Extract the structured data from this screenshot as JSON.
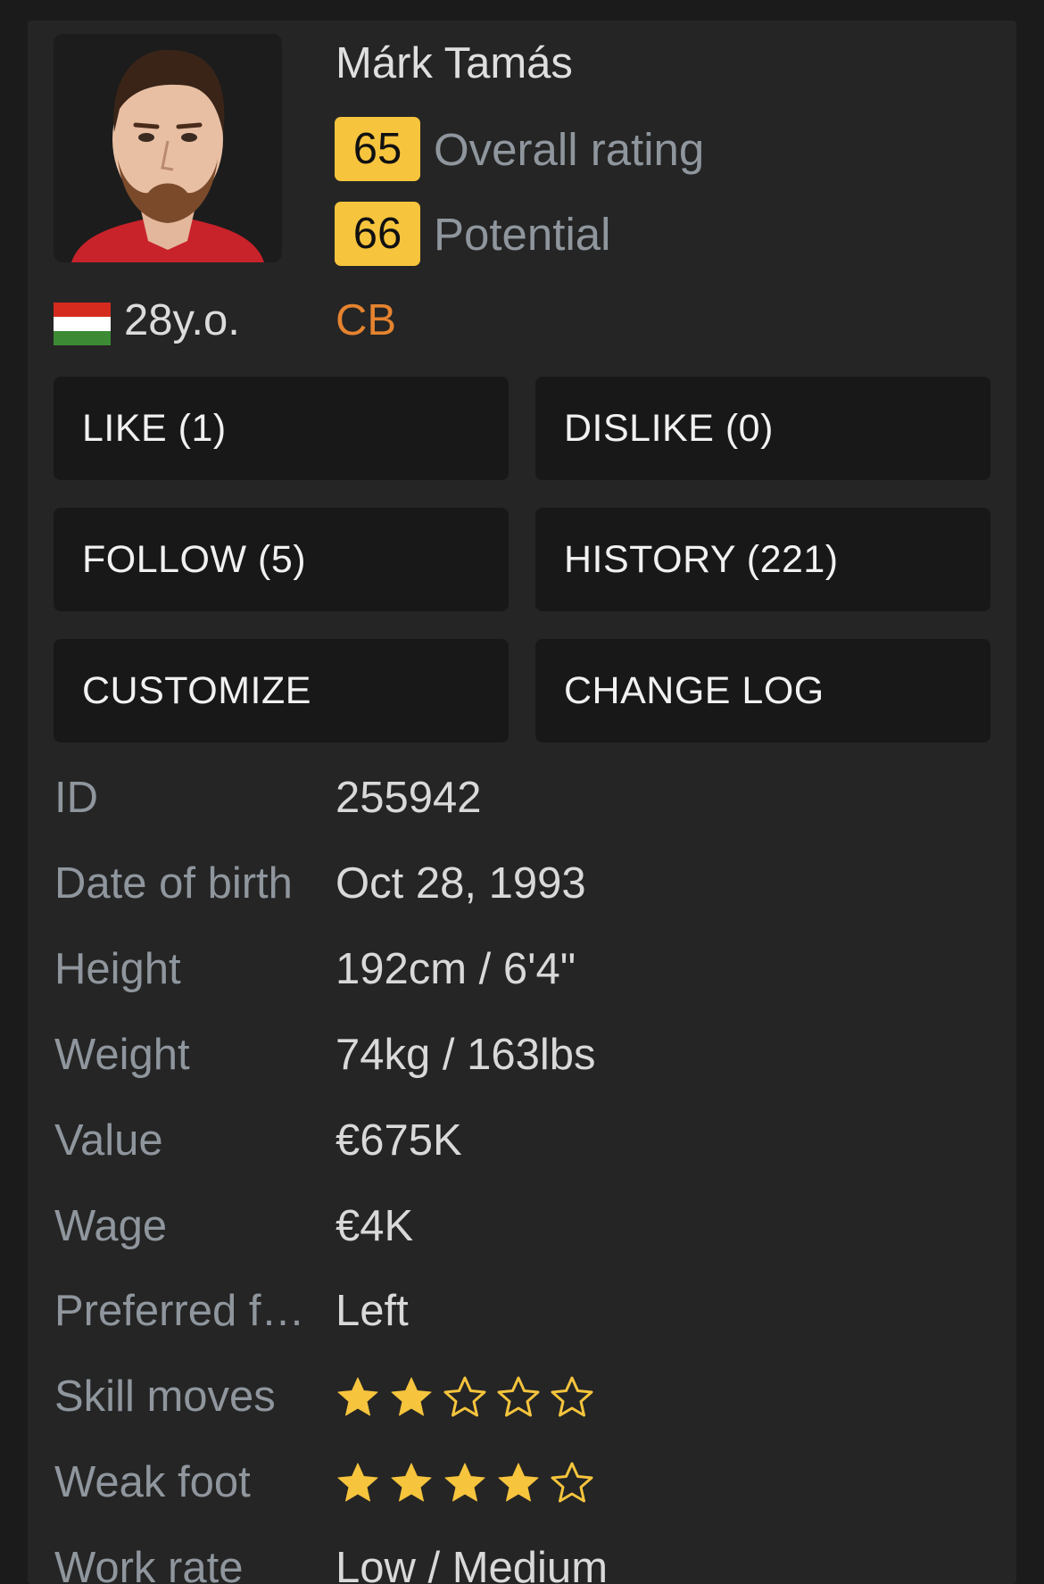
{
  "player": {
    "name": "Márk Tamás",
    "overall": "65",
    "overall_label": "Overall rating",
    "potential": "66",
    "potential_label": "Potential",
    "age": "28y.o.",
    "position": "CB",
    "flag_icon": "hungary-flag-icon"
  },
  "colors": {
    "badge": "#f6c43d",
    "position": "#e5832f",
    "star": "#f6c43d",
    "background": "#252525",
    "button": "#181818"
  },
  "buttons": {
    "like": "LIKE (1)",
    "dislike": "DISLIKE (0)",
    "follow": "FOLLOW (5)",
    "history": "HISTORY (221)",
    "customize": "CUSTOMIZE",
    "changelog": "CHANGE LOG"
  },
  "info": {
    "id": {
      "label": "ID",
      "value": "255942"
    },
    "dob": {
      "label": "Date of birth",
      "value": "Oct 28, 1993"
    },
    "height": {
      "label": "Height",
      "value": "192cm / 6'4\""
    },
    "weight": {
      "label": "Weight",
      "value": "74kg / 163lbs"
    },
    "value": {
      "label": "Value",
      "value": "€675K"
    },
    "wage": {
      "label": "Wage",
      "value": "€4K"
    },
    "foot": {
      "label": "Preferred foot",
      "value": "Left"
    },
    "skill": {
      "label": "Skill moves",
      "stars": 2,
      "max": 5
    },
    "weak": {
      "label": "Weak foot",
      "stars": 4,
      "max": 5
    },
    "workrate": {
      "label": "Work rate",
      "value": "Low / Medium"
    }
  }
}
